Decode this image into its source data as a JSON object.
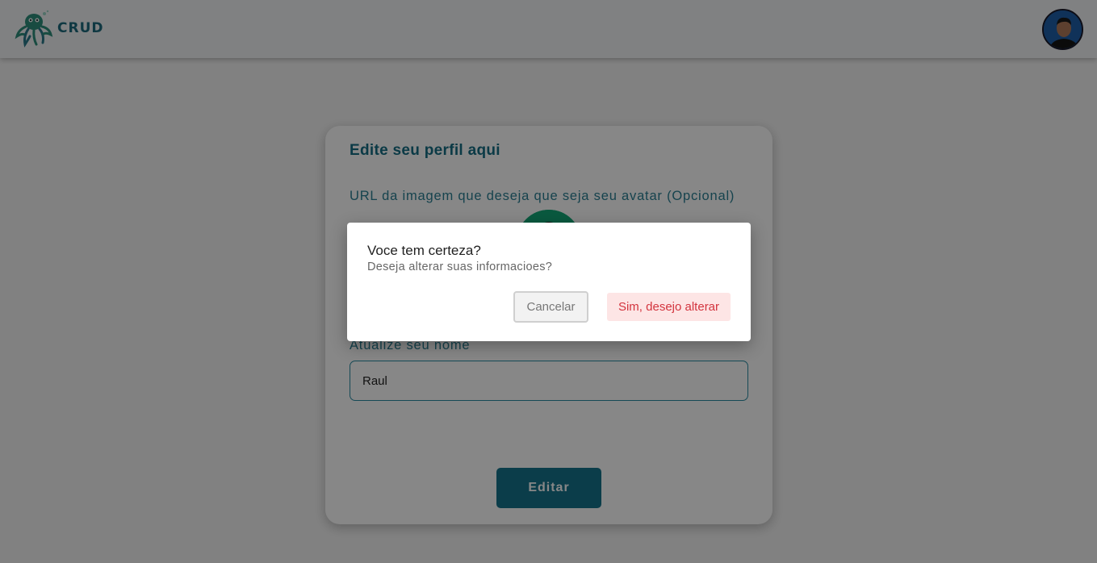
{
  "header": {
    "logo_text": "CRUD",
    "logo_icon": "octopus-icon",
    "user_avatar": "user-avatar-photo"
  },
  "profile_form": {
    "title": "Edite seu perfil aqui",
    "avatar_url_label": "URL da imagem que deseja que seja seu avatar (Opcional)",
    "name_label": "Atualize seu nome",
    "name_value": "Raul",
    "edit_button_label": "Editar"
  },
  "dialog": {
    "title": "Voce tem certeza?",
    "message": "Deseja alterar suas informacioes?",
    "cancel_label": "Cancelar",
    "confirm_label": "Sim, desejo alterar"
  },
  "colors": {
    "primary": "#16748d",
    "danger_text": "#d3343e",
    "danger_bg": "#fde5e5",
    "overlay": "rgba(0,0,0,0.47)"
  }
}
